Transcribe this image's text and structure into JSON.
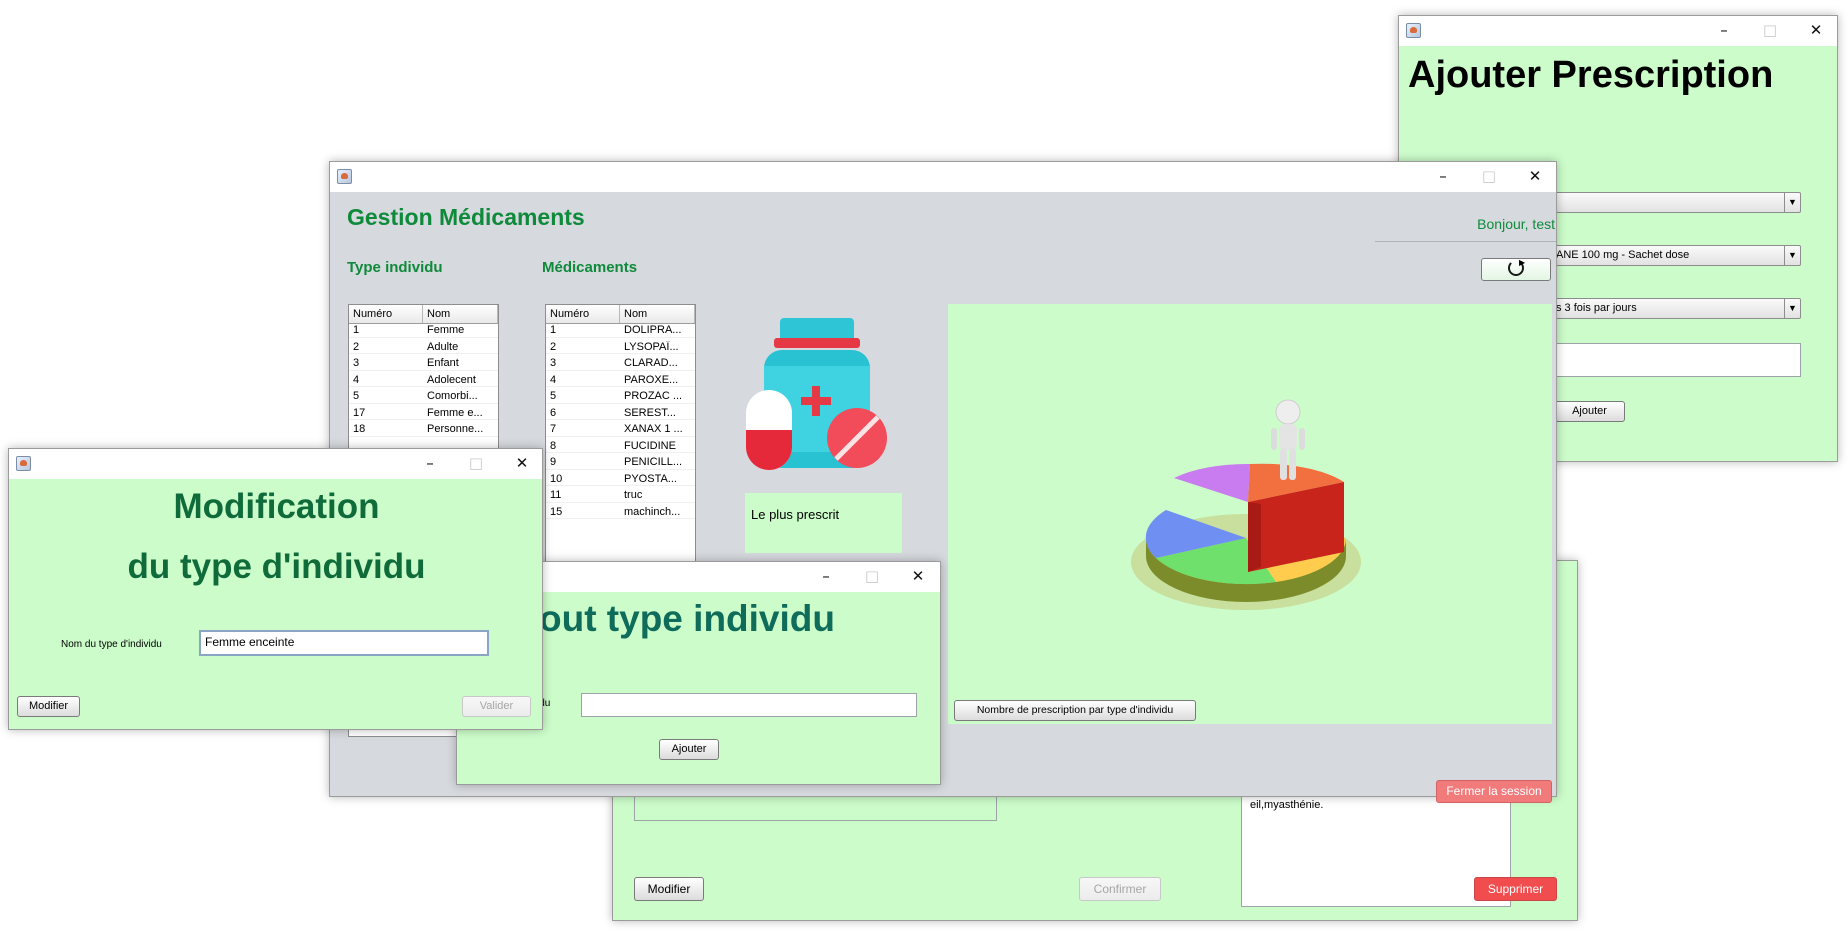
{
  "colors": {
    "app_bg": "#d6d9de",
    "panel_green": "#ccfcca",
    "title_green": "#0f8a3a",
    "dark_teal": "#0f6b5a",
    "danger": "#f14d4f"
  },
  "bg_window": {
    "field_value": "eil,myasthénie.",
    "modifier_label": "Modifier",
    "confirmer_label": "Confirmer",
    "supprimer_label": "Supprimer"
  },
  "prescription_window": {
    "title": "Ajouter Prescription",
    "combo2_value": "ANE 100 mg - Sachet dose",
    "combo3_value": "s 3 fois par jours",
    "add_label": "Ajouter",
    "icons": [
      "java-app-icon",
      "minimize-icon",
      "maximize-icon",
      "close-icon",
      "dropdown-arrow-icon"
    ]
  },
  "main_window": {
    "title": "Gestion Médicaments",
    "greeting": "Bonjour, test",
    "type_individu_title": "Type individu",
    "medicaments_title": "Médicaments",
    "type_table": {
      "headers": [
        "Numéro",
        "Nom"
      ],
      "rows": [
        [
          "1",
          "Femme"
        ],
        [
          "2",
          "Adulte"
        ],
        [
          "3",
          "Enfant"
        ],
        [
          "4",
          "Adolecent"
        ],
        [
          "5",
          "Comorbi..."
        ],
        [
          "17",
          "Femme e..."
        ],
        [
          "18",
          "Personne..."
        ]
      ]
    },
    "med_table": {
      "headers": [
        "Numéro",
        "Nom"
      ],
      "rows": [
        [
          "1",
          "DOLIPRA..."
        ],
        [
          "2",
          "LYSOPAÏ..."
        ],
        [
          "3",
          "CLARAD..."
        ],
        [
          "4",
          "PAROXE..."
        ],
        [
          "5",
          "PROZAC ..."
        ],
        [
          "6",
          "SEREST..."
        ],
        [
          "7",
          "XANAX 1 ..."
        ],
        [
          "8",
          "FUCIDINE"
        ],
        [
          "9",
          "PENICILL..."
        ],
        [
          "10",
          "PYOSTA..."
        ],
        [
          "11",
          "truc"
        ],
        [
          "15",
          "machinch..."
        ]
      ]
    },
    "most_prescribed_label": "Le plus prescrit",
    "chart_button_label": "Nombre de prescription par type d'individu",
    "logout_label": "Fermer la session",
    "icons": [
      "refresh-icon",
      "medicine-bottle-icon",
      "pie-chart-3d-image"
    ]
  },
  "ajout_window": {
    "title": "out type individu",
    "field_label": "idu",
    "add_label": "Ajouter"
  },
  "modif_window": {
    "title_line1": "Modification",
    "title_line2": "du type d'individu",
    "field_label": "Nom du type d'individu",
    "field_value": "Femme enceinte",
    "modifier_label": "Modifier",
    "valider_label": "Valider"
  }
}
